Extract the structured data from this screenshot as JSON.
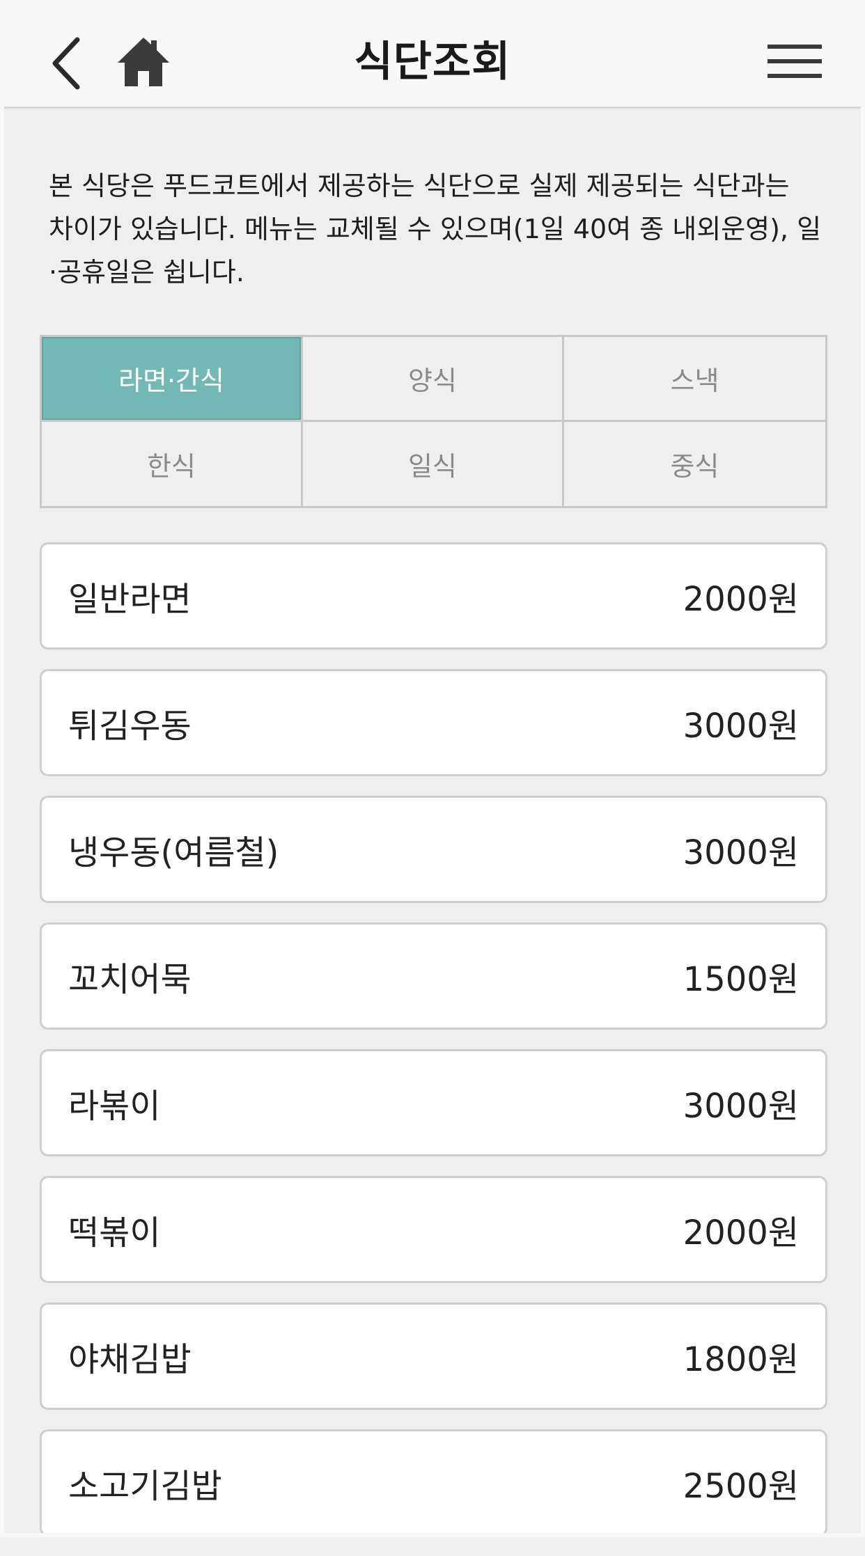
{
  "header": {
    "title": "식단조회",
    "back_icon": "chevron-left-icon",
    "home_icon": "home-icon",
    "menu_icon": "hamburger-menu-icon"
  },
  "notice": "본 식당은 푸드코트에서 제공하는 식단으로 실제 제공되는 식단과는 차이가 있습니다. 메뉴는 교체될 수 있으며(1일 40여 종 내외운영), 일·공휴일은 쉽니다.",
  "categories": {
    "active_index": 0,
    "items": [
      "라면·간식",
      "양식",
      "스낵",
      "한식",
      "일식",
      "중식"
    ]
  },
  "menu": [
    {
      "name": "일반라면",
      "price": "2000원"
    },
    {
      "name": "튀김우동",
      "price": "3000원"
    },
    {
      "name": "냉우동(여름철)",
      "price": "3000원"
    },
    {
      "name": "꼬치어묵",
      "price": "1500원"
    },
    {
      "name": "라볶이",
      "price": "3000원"
    },
    {
      "name": "떡볶이",
      "price": "2000원"
    },
    {
      "name": "야채김밥",
      "price": "1800원"
    },
    {
      "name": "소고기김밥",
      "price": "2500원"
    }
  ],
  "colors": {
    "accent": "#72b8b5",
    "background": "#efefef",
    "header": "#f8f8f8"
  }
}
